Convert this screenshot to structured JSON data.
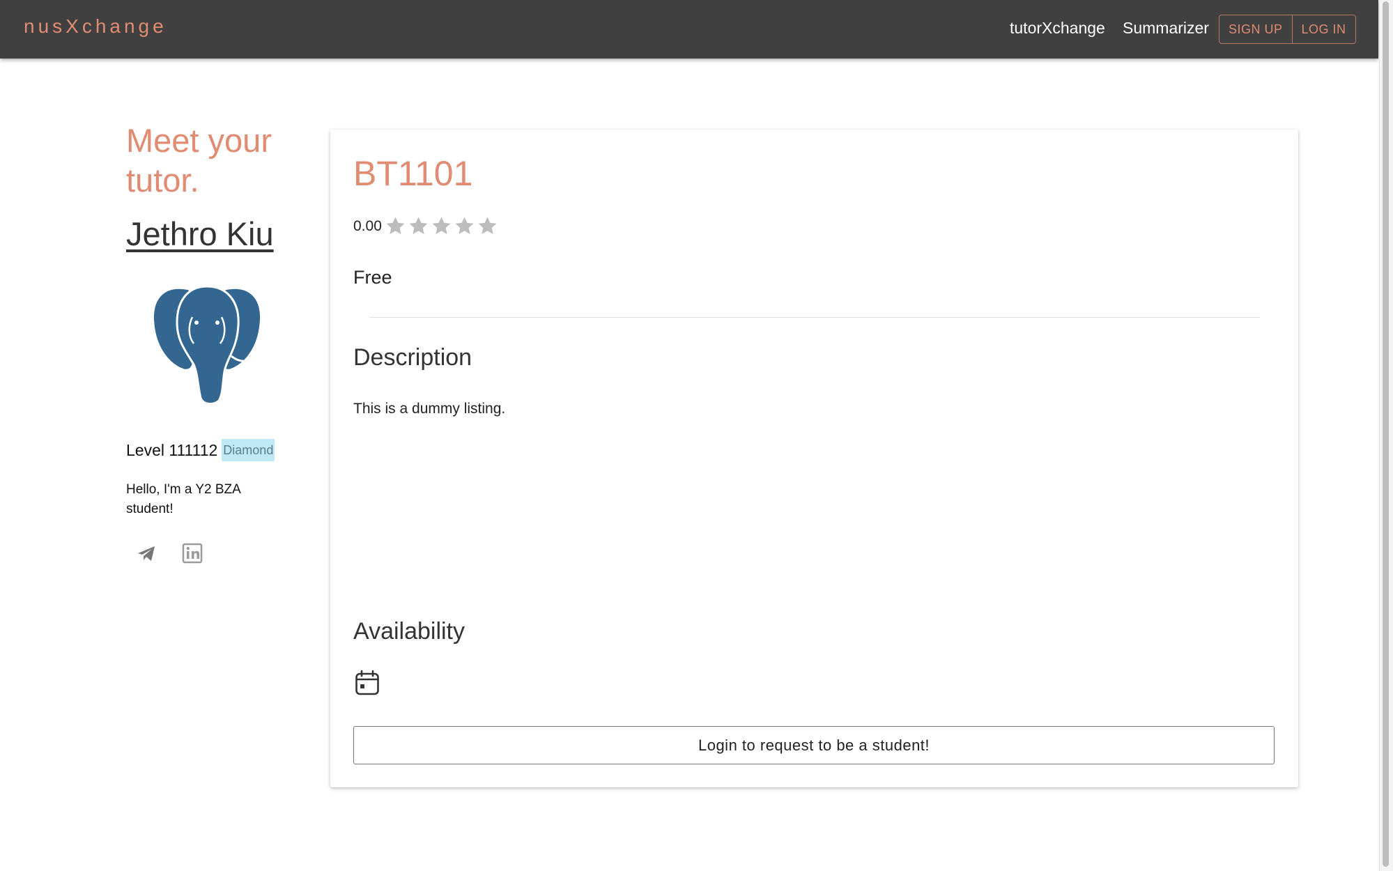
{
  "navbar": {
    "brand": "nusXchange",
    "links": {
      "tutorxchange": "tutorXchange",
      "summarizer": "Summarizer"
    },
    "signup_label": "SIGN UP",
    "login_label": "LOG IN"
  },
  "profile": {
    "heading": "Meet your tutor.",
    "name": "Jethro Kiu",
    "avatar_icon": "elephant-avatar",
    "level_text": "Level 111112",
    "badge": "Diamond",
    "bio": "Hello, I'm a Y2 BZA student!",
    "social_icons": [
      "telegram-icon",
      "linkedin-icon"
    ]
  },
  "listing": {
    "course_code": "BT1101",
    "rating": "0.00",
    "rating_stars_filled": 0,
    "rating_stars_total": 5,
    "price": "Free",
    "description_heading": "Description",
    "description": "This is a dummy listing.",
    "availability_heading": "Availability",
    "availability_icon": "calendar-icon",
    "request_button": "Login to request to be a student!"
  },
  "colors": {
    "accent": "#e08b72",
    "navbar_bg": "#404040",
    "badge_bg": "#bfe9f4",
    "avatar_blue": "#336791"
  }
}
